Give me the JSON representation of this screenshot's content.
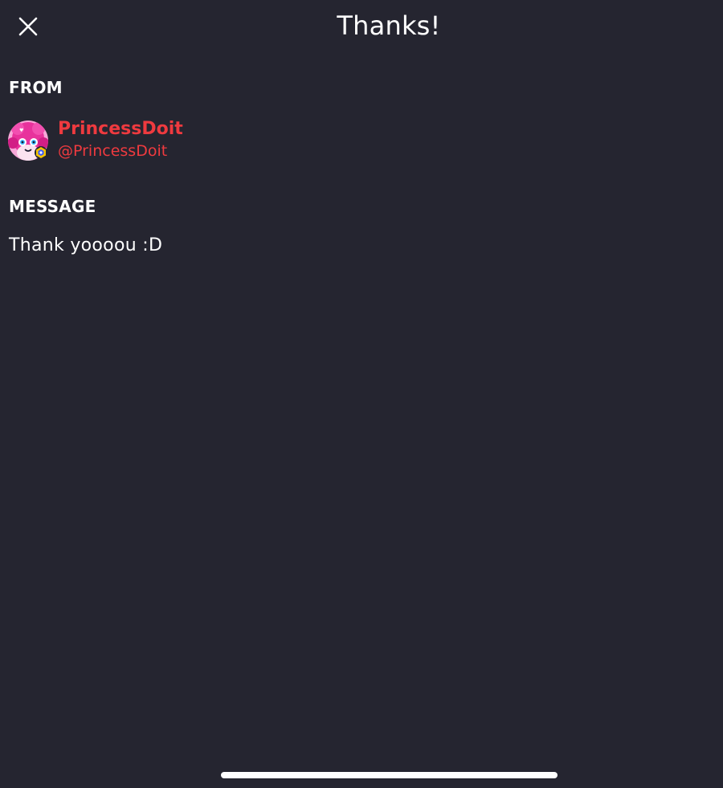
{
  "header": {
    "title": "Thanks!",
    "close_icon": "close-icon"
  },
  "from": {
    "label": "FROM",
    "sender_name": "PrincessDoit",
    "sender_handle": "@PrincessDoit",
    "name_color": "#ef3a3f",
    "avatar_icon": "avatar-pink-character"
  },
  "message": {
    "label": "MESSAGE",
    "text": "Thank yoooou :D"
  },
  "colors": {
    "background": "#252530",
    "text": "#ffffff",
    "accent": "#ef3a3f"
  }
}
